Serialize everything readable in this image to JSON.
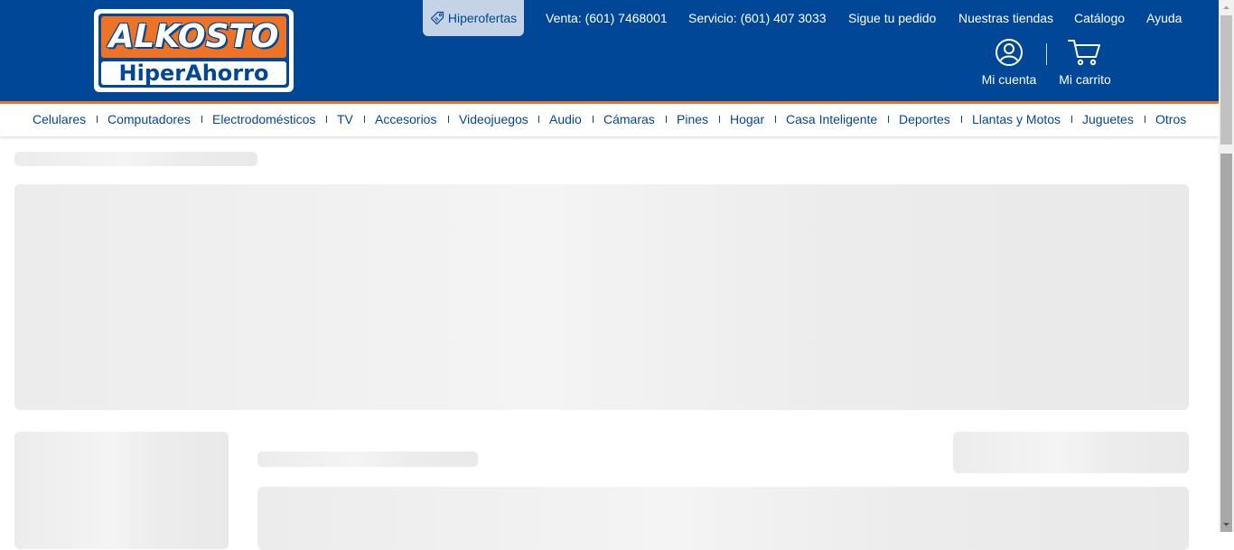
{
  "colors": {
    "brand_blue": "#004797",
    "brand_orange": "#ee7325",
    "skeleton": "#ececec"
  },
  "logo": {
    "top": "ALKOSTO",
    "bottom": "HiperAhorro"
  },
  "hiperofertas": {
    "label": "Hiperofertas",
    "icon": "tag-icon"
  },
  "toplinks": {
    "venta": "Venta: (601) 7468001",
    "servicio": "Servicio: (601) 407 3033",
    "pedido": "Sigue tu pedido",
    "tiendas": "Nuestras tiendas",
    "catalogo": "Catálogo",
    "ayuda": "Ayuda"
  },
  "account": {
    "label": "Mi cuenta",
    "icon": "user-circle-icon"
  },
  "cart": {
    "label": "Mi carrito",
    "icon": "shopping-cart-icon"
  },
  "categories": [
    "Celulares",
    "Computadores",
    "Electrodomésticos",
    "TV",
    "Accesorios",
    "Videojuegos",
    "Audio",
    "Cámaras",
    "Pines",
    "Hogar",
    "Casa Inteligente",
    "Deportes",
    "Llantas y Motos",
    "Juguetes",
    "Otros"
  ]
}
